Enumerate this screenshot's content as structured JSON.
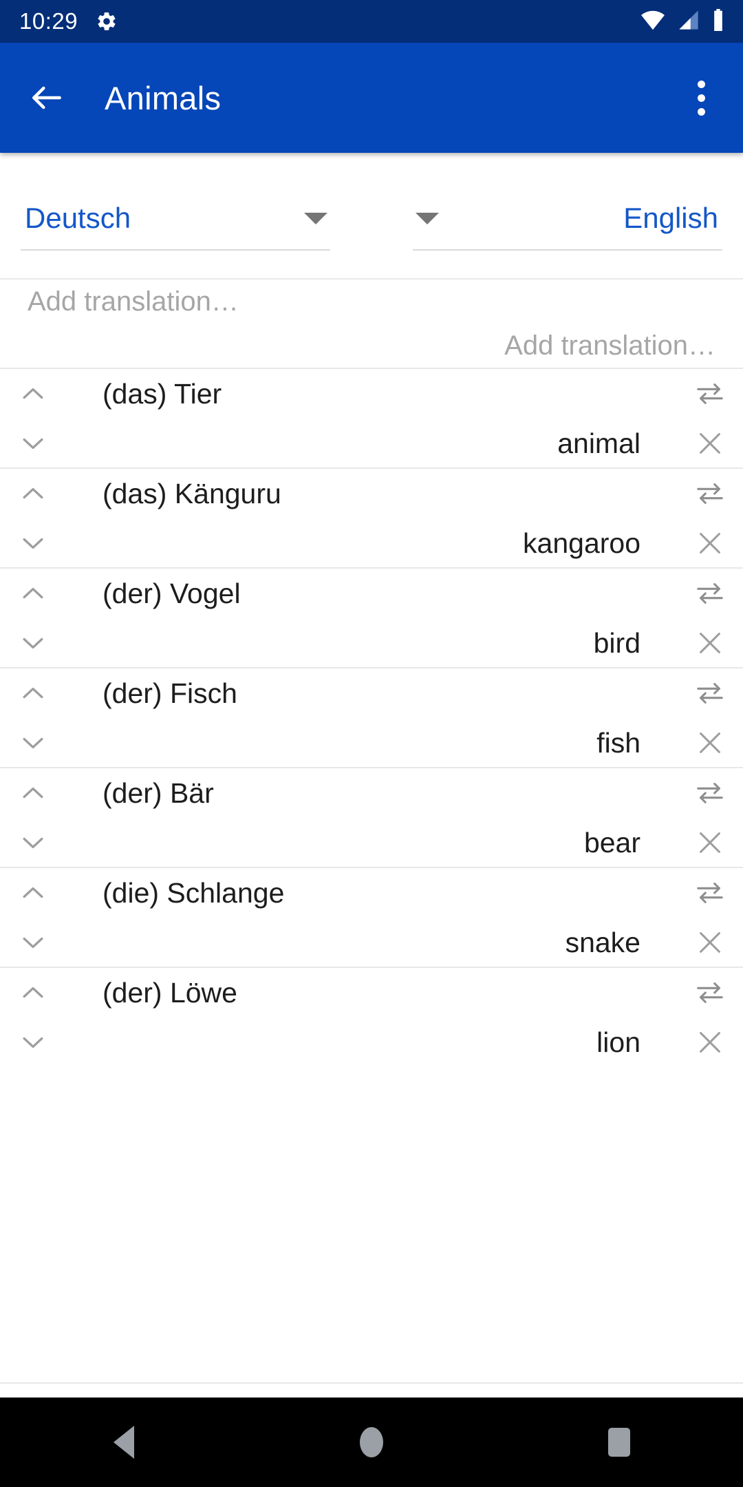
{
  "status_bar": {
    "time": "10:29",
    "icons": [
      "gear-icon",
      "wifi-icon",
      "cellular-signal-icon",
      "battery-icon"
    ],
    "background": "#042e78"
  },
  "app_bar": {
    "title": "Animals",
    "back_icon": "arrow-left-icon",
    "overflow_icon": "more-vertical-icon",
    "background": "#0546b8"
  },
  "language_selector": {
    "source": {
      "label": "Deutsch",
      "arrow_icon": "dropdown-arrow-icon"
    },
    "target": {
      "label": "English",
      "arrow_icon": "dropdown-arrow-icon"
    },
    "accent_color": "#1457c8"
  },
  "add_translation": {
    "source_placeholder": "Add translation…",
    "target_placeholder": "Add translation…"
  },
  "entries": [
    {
      "source": "(das) Tier",
      "target": "animal",
      "expand_icon": "chevron-up-icon",
      "collapse_icon": "chevron-down-icon",
      "swap_icon": "swap-horizontal-icon",
      "delete_icon": "close-icon"
    },
    {
      "source": "(das) Känguru",
      "target": "kangaroo",
      "expand_icon": "chevron-up-icon",
      "collapse_icon": "chevron-down-icon",
      "swap_icon": "swap-horizontal-icon",
      "delete_icon": "close-icon"
    },
    {
      "source": "(der) Vogel",
      "target": "bird",
      "expand_icon": "chevron-up-icon",
      "collapse_icon": "chevron-down-icon",
      "swap_icon": "swap-horizontal-icon",
      "delete_icon": "close-icon"
    },
    {
      "source": "(der) Fisch",
      "target": "fish",
      "expand_icon": "chevron-up-icon",
      "collapse_icon": "chevron-down-icon",
      "swap_icon": "swap-horizontal-icon",
      "delete_icon": "close-icon"
    },
    {
      "source": "(der) Bär",
      "target": "bear",
      "expand_icon": "chevron-up-icon",
      "collapse_icon": "chevron-down-icon",
      "swap_icon": "swap-horizontal-icon",
      "delete_icon": "close-icon"
    },
    {
      "source": "(die) Schlange",
      "target": "snake",
      "expand_icon": "chevron-up-icon",
      "collapse_icon": "chevron-down-icon",
      "swap_icon": "swap-horizontal-icon",
      "delete_icon": "close-icon"
    },
    {
      "source": "(der) Löwe",
      "target": "lion",
      "expand_icon": "chevron-up-icon",
      "collapse_icon": "chevron-down-icon",
      "swap_icon": "swap-horizontal-icon",
      "delete_icon": "close-icon"
    }
  ],
  "navigation_bar": {
    "back": "back-triangle-icon",
    "home": "home-circle-icon",
    "recents": "recents-square-icon"
  }
}
